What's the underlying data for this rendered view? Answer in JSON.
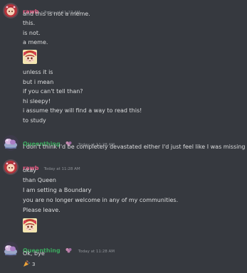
{
  "messages": [
    {
      "author": "rawb",
      "timestamp": "Today at 11:27 AM",
      "lines": [
        "and this is not a meme.",
        "this.",
        "is not.",
        "a meme."
      ],
      "lines_after_emoji": [
        "unless it is",
        "but i mean",
        "if you can't tell than?",
        "hi sleepy!",
        "i assume they will find a way to read this!",
        "to study"
      ],
      "emoji_icon": "sad-anime-girl-emoji"
    },
    {
      "author": "Queenthing",
      "timestamp": "Today at 11:28 AM",
      "lines": [
        "I don't think I'd be completely devastated either I'd just feel like I was missing out"
      ]
    },
    {
      "author": "rawb",
      "timestamp": "Today at 11:28 AM",
      "lines": [
        "okay",
        "than Queen",
        "I am setting a Boundary",
        "you are no longer welcome in any of my communities.",
        "Please leave."
      ],
      "emoji_icon": "sad-anime-girl-emoji"
    },
    {
      "author": "Queenthing",
      "timestamp": "Today at 11:28 AM",
      "lines": [
        "Ok, bye"
      ],
      "reaction": {
        "icon": "party-popper-icon",
        "count": "3"
      }
    }
  ],
  "colors": {
    "background": "#36393f",
    "rawb_name": "#ed5a84",
    "queen_name": "#3ba55d",
    "text": "#dcddde",
    "timestamp": "#8e9297"
  }
}
